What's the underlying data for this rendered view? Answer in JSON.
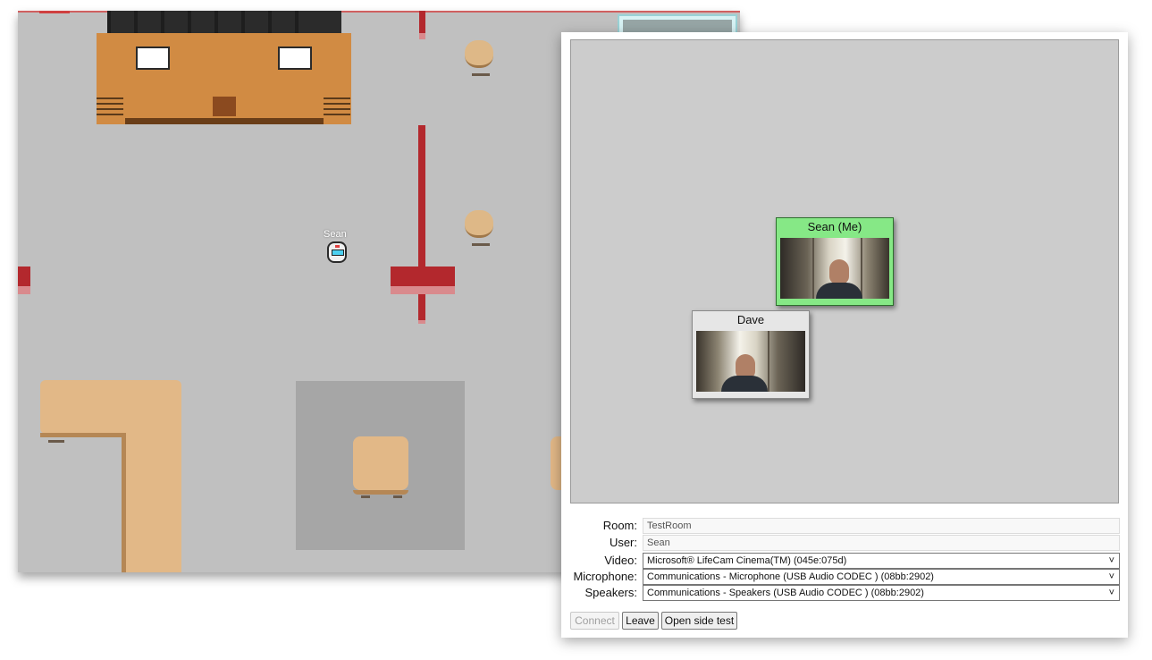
{
  "game": {
    "avatar": {
      "name": "Sean"
    }
  },
  "chat": {
    "participants": [
      {
        "name": "Sean (Me)",
        "is_self": true,
        "border_color": "#86e886"
      },
      {
        "name": "Dave",
        "is_self": false,
        "border_color": "#e6e6e6"
      }
    ]
  },
  "form": {
    "room": {
      "label": "Room:",
      "value": "TestRoom"
    },
    "user": {
      "label": "User:",
      "value": "Sean"
    },
    "video": {
      "label": "Video:",
      "value": "Microsoft® LifeCam Cinema(TM) (045e:075d)"
    },
    "microphone": {
      "label": "Microphone:",
      "value": "Communications - Microphone (USB Audio CODEC ) (08bb:2902)"
    },
    "speakers": {
      "label": "Speakers:",
      "value": "Communications - Speakers (USB Audio CODEC ) (08bb:2902)"
    }
  },
  "buttons": {
    "connect": "Connect",
    "leave": "Leave",
    "open_side_test": "Open side test"
  },
  "icons": {
    "dropdown": "chevron-down-icon"
  }
}
